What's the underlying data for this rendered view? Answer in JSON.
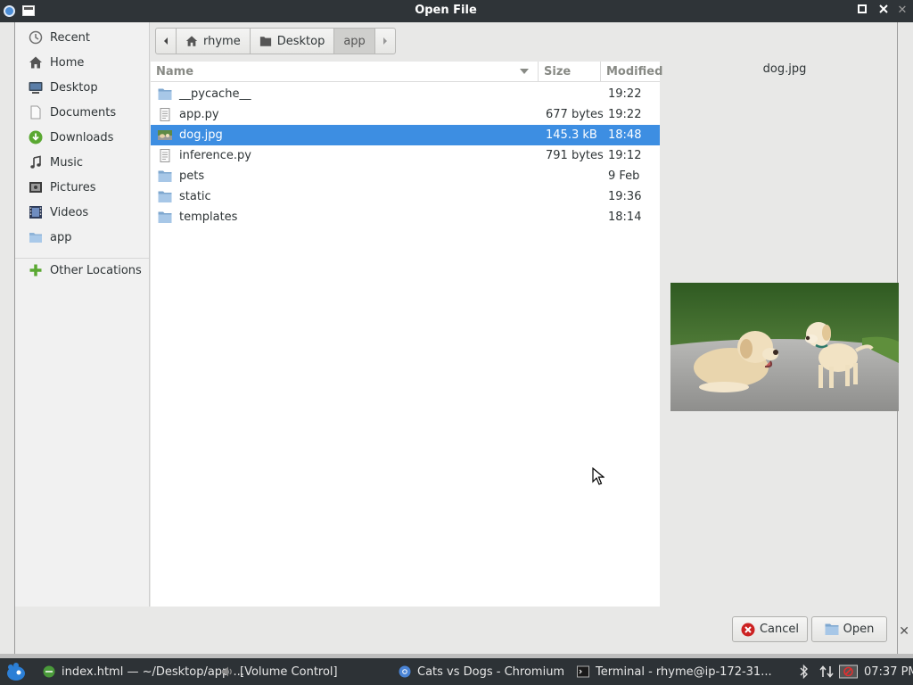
{
  "window": {
    "title": "Open File"
  },
  "sidebar": {
    "items": [
      {
        "label": "Recent",
        "icon": "clock-icon"
      },
      {
        "label": "Home",
        "icon": "home-icon"
      },
      {
        "label": "Desktop",
        "icon": "desktop-icon"
      },
      {
        "label": "Documents",
        "icon": "document-icon"
      },
      {
        "label": "Downloads",
        "icon": "download-icon"
      },
      {
        "label": "Music",
        "icon": "music-icon"
      },
      {
        "label": "Pictures",
        "icon": "pictures-icon"
      },
      {
        "label": "Videos",
        "icon": "film-icon"
      },
      {
        "label": "app",
        "icon": "folder-icon"
      }
    ],
    "other_locations": "Other Locations"
  },
  "pathbar": {
    "home": "rhyme",
    "desktop": "Desktop",
    "current": "app"
  },
  "filelist": {
    "columns": {
      "name": "Name",
      "size": "Size",
      "modified": "Modified"
    },
    "rows": [
      {
        "name": "__pycache__",
        "size": "",
        "modified": "19:22",
        "type": "folder"
      },
      {
        "name": "app.py",
        "size": "677 bytes",
        "modified": "19:22",
        "type": "text"
      },
      {
        "name": "dog.jpg",
        "size": "145.3 kB",
        "modified": "18:48",
        "type": "image",
        "selected": true
      },
      {
        "name": "inference.py",
        "size": "791 bytes",
        "modified": "19:12",
        "type": "text"
      },
      {
        "name": "pets",
        "size": "",
        "modified": "9 Feb",
        "type": "folder"
      },
      {
        "name": "static",
        "size": "",
        "modified": "19:36",
        "type": "folder"
      },
      {
        "name": "templates",
        "size": "",
        "modified": "18:14",
        "type": "folder"
      }
    ]
  },
  "preview": {
    "filename": "dog.jpg"
  },
  "buttons": {
    "cancel": "Cancel",
    "open": "Open"
  },
  "taskbar": {
    "tasks": [
      {
        "label": "index.html — ~/Desktop/app ..."
      },
      {
        "label": "[Volume Control]"
      },
      {
        "label": "Cats vs Dogs - Chromium"
      },
      {
        "label": "Terminal - rhyme@ip-172-31..."
      }
    ],
    "clock": "07:37 PM"
  },
  "colors": {
    "selection": "#3d8ee2",
    "titlebar": "#2f3438",
    "taskbar": "#2d3236"
  }
}
